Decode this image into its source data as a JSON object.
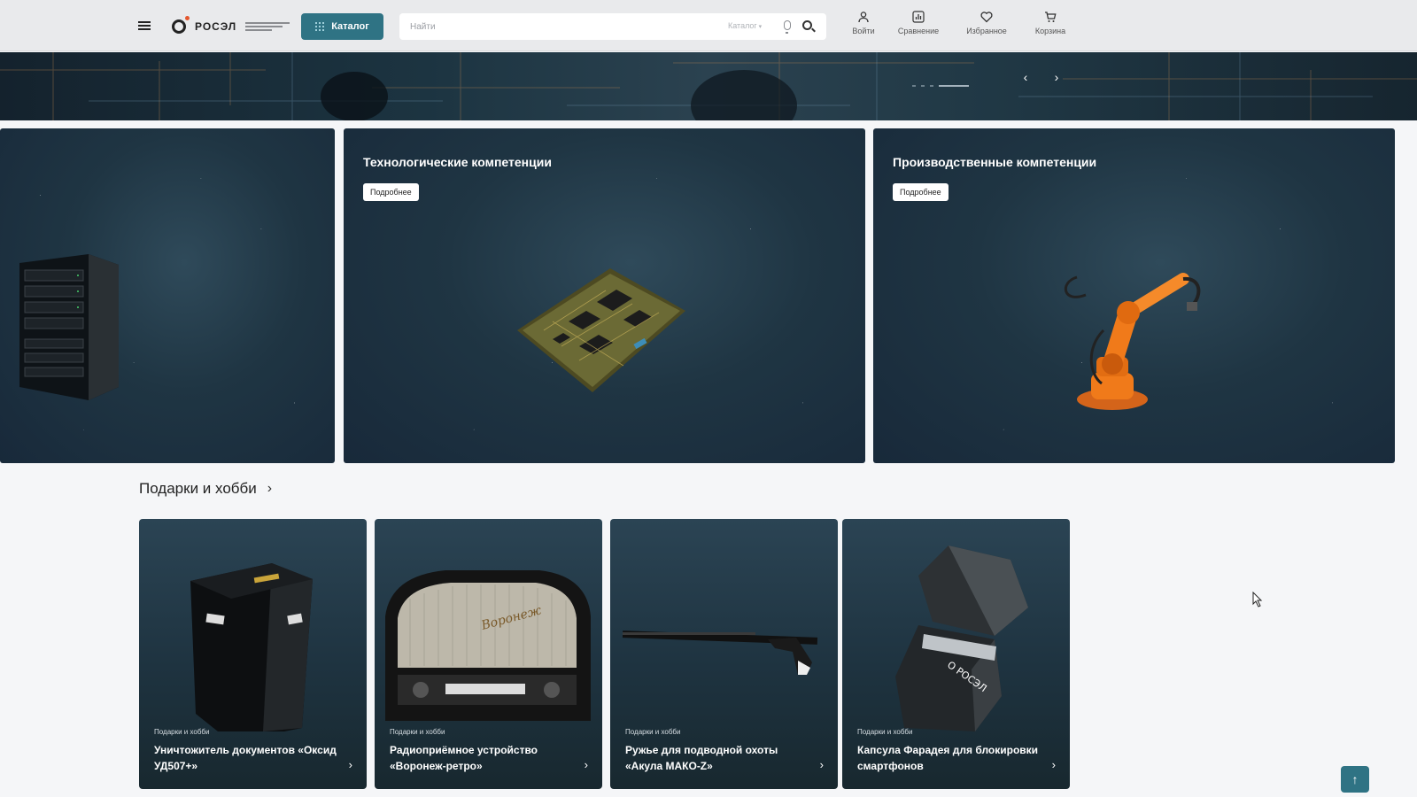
{
  "header": {
    "logo_text": "РОСЭЛ",
    "catalog_label": "Каталог",
    "search_placeholder": "Найти",
    "search_scope": "Каталог",
    "actions": [
      {
        "label": "Войти",
        "icon": "user-icon"
      },
      {
        "label": "Сравнение",
        "icon": "compare-icon"
      },
      {
        "label": "Избранное",
        "icon": "heart-icon"
      },
      {
        "label": "Корзина",
        "icon": "cart-icon"
      }
    ]
  },
  "banner": {
    "prev_label": "‹",
    "next_label": "›"
  },
  "competences": [
    {
      "title": "",
      "button": "",
      "image": "server-rack"
    },
    {
      "title": "Технологические компетенции",
      "button": "Подробнее",
      "image": "circuit-board"
    },
    {
      "title": "Производственные компетенции",
      "button": "Подробнее",
      "image": "industrial-robot"
    }
  ],
  "section": {
    "title": "Подарки и хобби",
    "chevron": "›"
  },
  "products": [
    {
      "category": "Подарки и хобби",
      "name": "Уничтожитель документов «Оксид УД507+»",
      "arrow": "›"
    },
    {
      "category": "Подарки и хобби",
      "name": "Радиоприёмное устройство «Воронеж-ретро»",
      "arrow": "›"
    },
    {
      "category": "Подарки и хобби",
      "name": "Ружье для подводной охоты «Акула МАКО-Z»",
      "arrow": "›"
    },
    {
      "category": "Подарки и хобби",
      "name": "Капсула Фарадея для блокировки смартфонов",
      "arrow": "›"
    }
  ],
  "scroll_top_label": "↑",
  "colors": {
    "accent": "#2f7384",
    "header_bg": "#e9eaec",
    "card_bg": "#1f3543",
    "robot_orange": "#f07a1a"
  }
}
